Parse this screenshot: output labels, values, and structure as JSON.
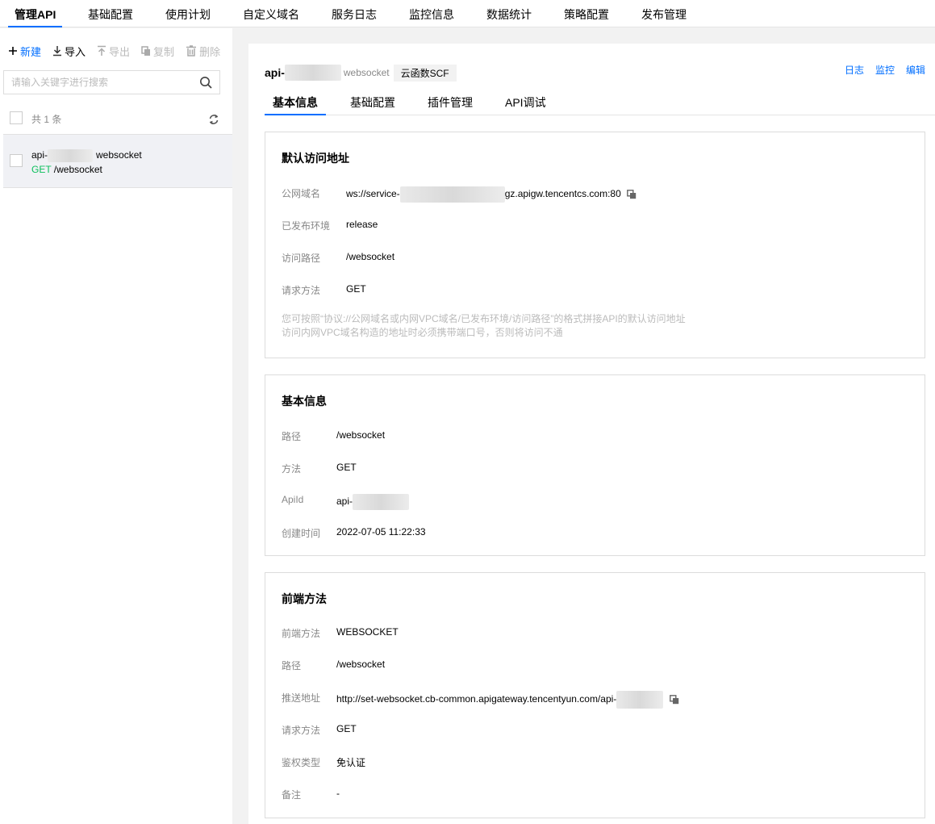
{
  "topnav": {
    "tabs": [
      {
        "label": "管理API",
        "active": true
      },
      {
        "label": "基础配置"
      },
      {
        "label": "使用计划"
      },
      {
        "label": "自定义域名"
      },
      {
        "label": "服务日志"
      },
      {
        "label": "监控信息"
      },
      {
        "label": "数据统计"
      },
      {
        "label": "策略配置"
      },
      {
        "label": "发布管理"
      }
    ]
  },
  "left": {
    "toolbar": {
      "new_label": "新建",
      "import_label": "导入",
      "export_label": "导出",
      "copy_label": "复制",
      "delete_label": "删除"
    },
    "search": {
      "placeholder": "请输入关键字进行搜索"
    },
    "count_label": "共 1 条",
    "api_list": [
      {
        "name_prefix": "api-",
        "protocol": "websocket",
        "method": "GET",
        "path": "/websocket"
      }
    ]
  },
  "right": {
    "header": {
      "api_name": "api-",
      "protocol": "websocket",
      "backend_tag": "云函数SCF",
      "links": {
        "log": "日志",
        "monitor": "监控",
        "edit": "编辑"
      }
    },
    "tabs": [
      "基本信息",
      "基础配置",
      "插件管理",
      "API调试"
    ],
    "default_access": {
      "title": "默认访问地址",
      "public_domain_label": "公网域名",
      "public_domain_prefix": "ws://service-",
      "public_domain_suffix": "gz.apigw.tencentcs.com:80",
      "env_label": "已发布环境",
      "env_value": "release",
      "path_label": "访问路径",
      "path_value": "/websocket",
      "method_label": "请求方法",
      "method_value": "GET",
      "note_line1": "您可按照“协议://公网域名或内网VPC域名/已发布环境/访问路径”的格式拼接API的默认访问地址",
      "note_line2": "访问内网VPC域名构造的地址时必须携带端口号，否则将访问不通"
    },
    "basic_info": {
      "title": "基本信息",
      "path_label": "路径",
      "path_value": "/websocket",
      "method_label": "方法",
      "method_value": "GET",
      "apiid_label": "ApiId",
      "apiid_prefix": "api-",
      "created_label": "创建时间",
      "created_value": "2022-07-05 11:22:33"
    },
    "frontend": {
      "title": "前端方法",
      "method_label": "前端方法",
      "method_value": "WEBSOCKET",
      "path_label": "路径",
      "path_value": "/websocket",
      "push_label": "推送地址",
      "push_value_prefix": "http://set-websocket.cb-common.apigateway.tencentyun.com/api-",
      "req_method_label": "请求方法",
      "req_method_value": "GET",
      "auth_label": "鉴权类型",
      "auth_value": "免认证",
      "remark_label": "备注",
      "remark_value": "-"
    }
  },
  "colors": {
    "accent": "#006eff",
    "method_get": "#0abf5b"
  }
}
